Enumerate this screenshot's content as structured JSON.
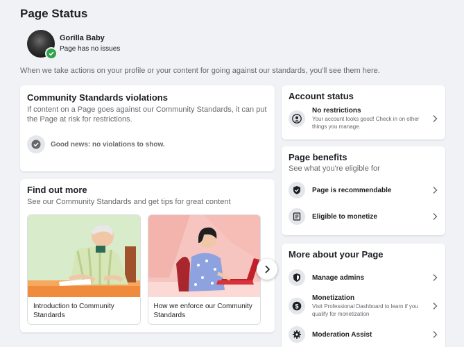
{
  "page": {
    "title": "Page Status",
    "intro": "When we take actions on your profile or your content for going against our standards, you'll see them here."
  },
  "profile": {
    "name": "Gorilla Baby",
    "status": "Page has no issues"
  },
  "violations": {
    "title": "Community Standards violations",
    "description": "If content on a Page goes against our Community Standards, it can put the Page at risk for restrictions.",
    "good_news": "Good news: no violations to show."
  },
  "find_out": {
    "title": "Find out more",
    "subtitle": "See our Community Standards and get tips for great content",
    "tips": [
      {
        "caption": "Introduction to Community Standards"
      },
      {
        "caption": "How we enforce our Community Standards"
      }
    ]
  },
  "account_status": {
    "title": "Account status",
    "item_label": "No restrictions",
    "item_desc": "Your account looks good! Check in on other things you manage."
  },
  "benefits": {
    "title": "Page benefits",
    "subtitle": "See what you're eligible for",
    "items": [
      {
        "label": "Page is recommendable",
        "icon": "shield-check-icon"
      },
      {
        "label": "Eligible to monetize",
        "icon": "document-icon"
      }
    ]
  },
  "more": {
    "title": "More about your Page",
    "items": [
      {
        "label": "Manage admins",
        "desc": "",
        "icon": "shield-icon"
      },
      {
        "label": "Monetization",
        "desc": "Visit Professional Dashboard to learn if you qualify for monetization",
        "icon": "dollar-icon"
      },
      {
        "label": "Moderation Assist",
        "desc": "",
        "icon": "gear-icon"
      }
    ]
  },
  "colors": {
    "background": "#f0f2f5",
    "success": "#31a24c",
    "icon_bg": "#e4e6eb"
  }
}
